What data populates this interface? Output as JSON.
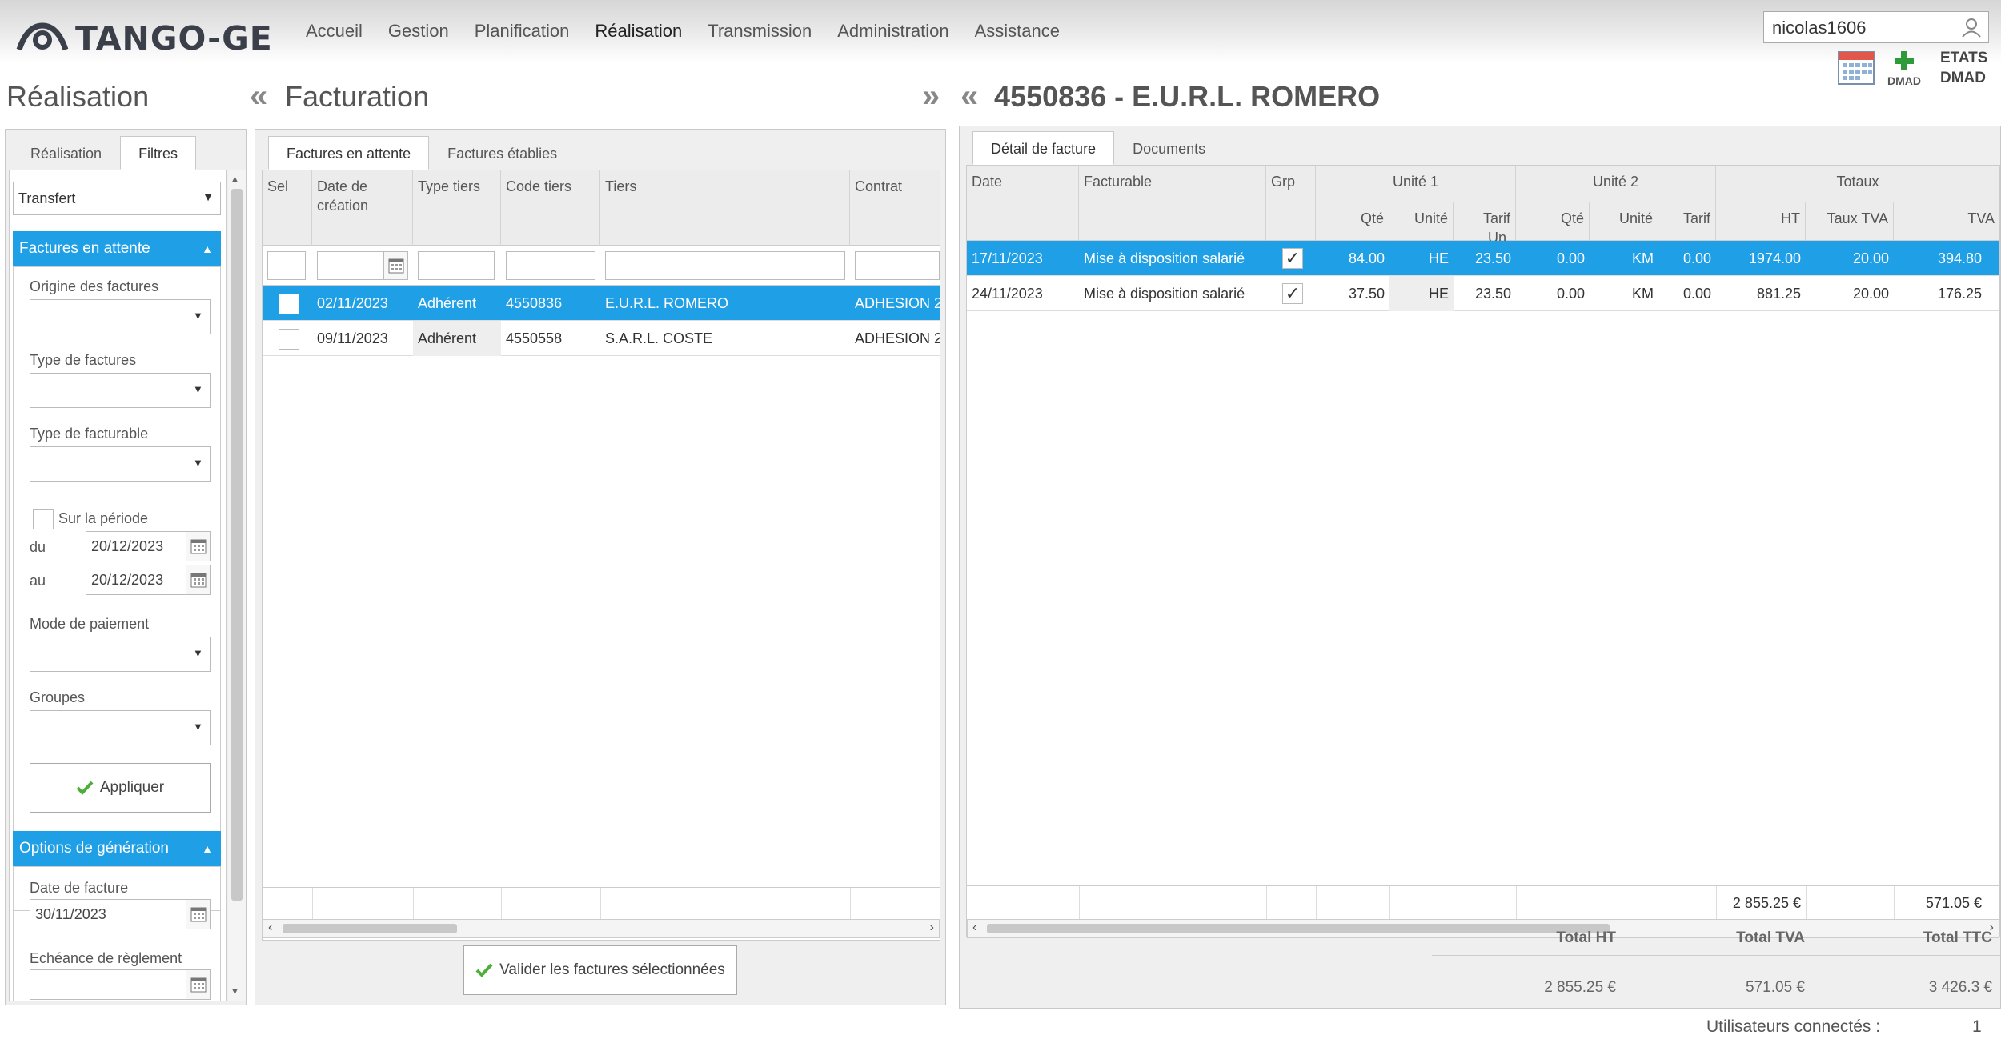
{
  "app": {
    "logo_text": "TANGO-GE"
  },
  "nav": [
    "Accueil",
    "Gestion",
    "Planification",
    "Réalisation",
    "Transmission",
    "Administration",
    "Assistance"
  ],
  "user": {
    "name": "nicolas1606"
  },
  "toolbar": {
    "dmad_label": "DMAD",
    "etats_label": "ETATS",
    "etats_sub": "DMAD"
  },
  "left": {
    "title": "Réalisation",
    "tabs": [
      "Réalisation",
      "Filtres"
    ],
    "transfer_select": "Transfert",
    "section1": "Factures en attente",
    "fields": {
      "origine": "Origine des factures",
      "type_factures": "Type de factures",
      "type_facturable": "Type de facturable",
      "periode": "Sur la période",
      "du": "du",
      "au": "au",
      "du_value": "20/12/2023",
      "au_value": "20/12/2023",
      "mode_paiement": "Mode de paiement",
      "groupes": "Groupes"
    },
    "apply_button": "Appliquer",
    "section2": "Options de génération",
    "date_facture_label": "Date de facture",
    "date_facture_value": "30/11/2023",
    "echeance_label": "Echéance de règlement"
  },
  "middle": {
    "title": "Facturation",
    "tabs": [
      "Factures en attente",
      "Factures établies"
    ],
    "columns": [
      "Sel",
      "Date de création",
      "Type tiers",
      "Code tiers",
      "Tiers",
      "Contrat"
    ],
    "rows": [
      {
        "date": "02/11/2023",
        "type": "Adhérent",
        "code": "4550836",
        "tiers": "E.U.R.L. ROMERO",
        "contrat": "ADHESION 2"
      },
      {
        "date": "09/11/2023",
        "type": "Adhérent",
        "code": "4550558",
        "tiers": "S.A.R.L. COSTE",
        "contrat": "ADHESION 2"
      }
    ],
    "validate_button": "Valider les factures sélectionnées"
  },
  "right": {
    "title": "4550836 - E.U.R.L. ROMERO",
    "tabs": [
      "Détail de facture",
      "Documents"
    ],
    "group_headers": {
      "date": "Date",
      "facturable": "Facturable",
      "grp": "Grp",
      "unite1": "Unité 1",
      "unite2": "Unité 2",
      "totaux": "Totaux"
    },
    "sub_headers": [
      "Qté",
      "Unité",
      "Tarif Un.",
      "Qté",
      "Unité",
      "Tarif",
      "HT",
      "Taux TVA",
      "TVA"
    ],
    "rows": [
      {
        "date": "17/11/2023",
        "facturable": "Mise à disposition salarié",
        "q1": "84.00",
        "u1": "HE",
        "t1": "23.50",
        "q2": "0.00",
        "u2": "KM",
        "t2": "0.00",
        "ht": "1974.00",
        "taux": "20.00",
        "tva": "394.80"
      },
      {
        "date": "24/11/2023",
        "facturable": "Mise à disposition salarié",
        "q1": "37.50",
        "u1": "HE",
        "t1": "23.50",
        "q2": "0.00",
        "u2": "KM",
        "t2": "0.00",
        "ht": "881.25",
        "taux": "20.00",
        "tva": "176.25"
      }
    ],
    "footer_ht": "2 855.25 €",
    "footer_tva": "571.05 €",
    "totals": {
      "ht_label": "Total HT",
      "tva_label": "Total TVA",
      "ttc_label": "Total TTC",
      "ht": "2 855.25 €",
      "tva": "571.05 €",
      "ttc": "3 426.3 €"
    }
  },
  "status": {
    "label": "Utilisateurs connectés :",
    "count": "1"
  }
}
